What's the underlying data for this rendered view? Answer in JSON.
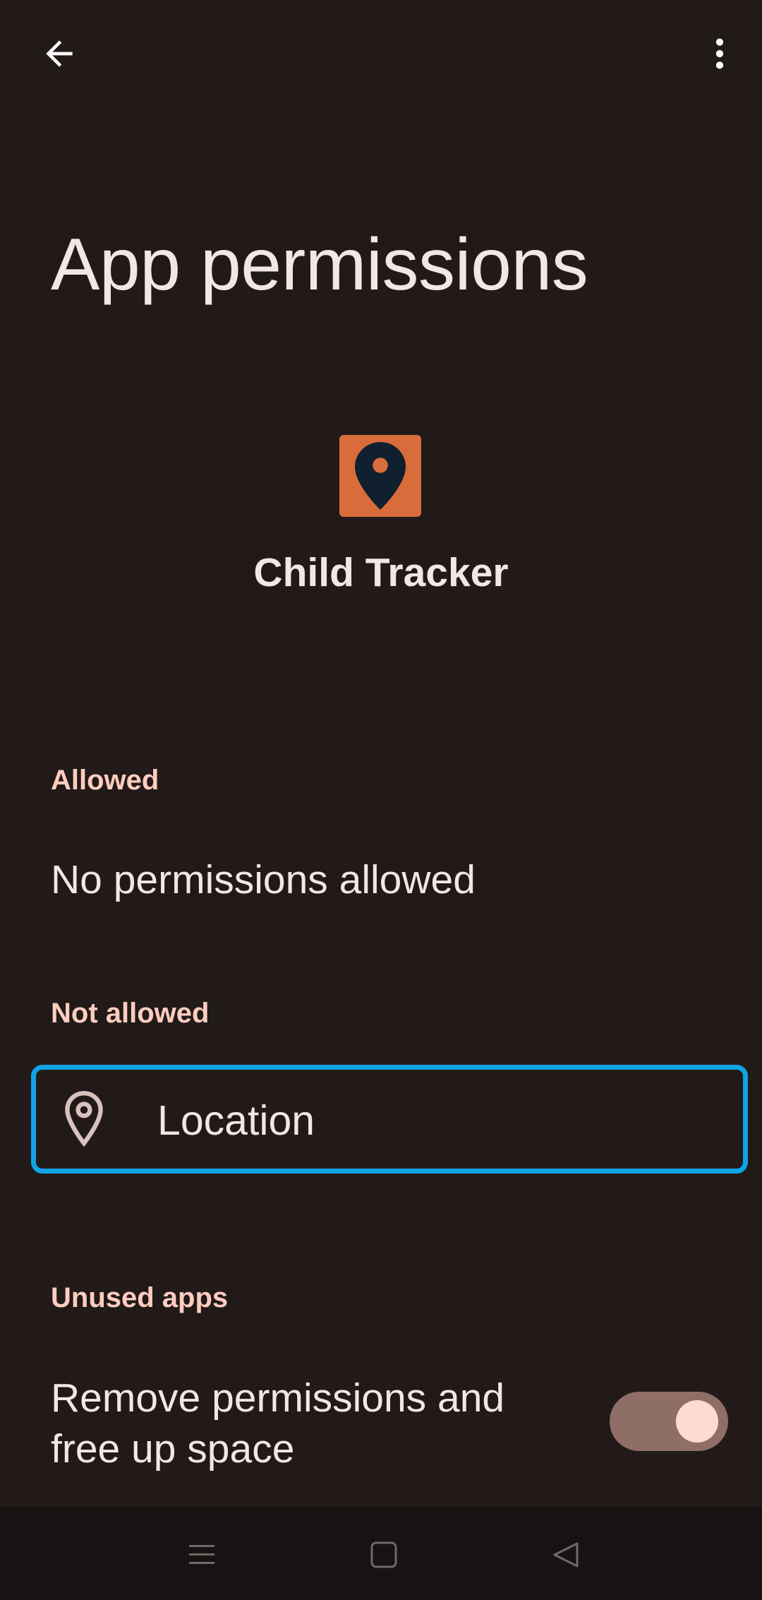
{
  "header": {
    "back_icon": "arrow-back-icon",
    "more_icon": "more-vert-icon",
    "title": "App permissions"
  },
  "app": {
    "icon": "location-pin-icon",
    "icon_bg": "#d96c3b",
    "name": "Child Tracker"
  },
  "sections": {
    "allowed": {
      "header": "Allowed",
      "empty_text": "No permissions allowed"
    },
    "not_allowed": {
      "header": "Not allowed",
      "items": [
        {
          "label": "Location",
          "icon": "location-outline-icon",
          "focused": true
        }
      ]
    },
    "unused_apps": {
      "header": "Unused apps",
      "setting_label_line1": "Remove permissions and",
      "setting_label_line2": "free up space",
      "toggle_on": true
    }
  },
  "navbar": {
    "recents_icon": "menu-icon",
    "home_icon": "home-square-icon",
    "back_icon": "back-triangle-icon"
  },
  "colors": {
    "background": "#211a19",
    "accent_header": "#ffcdbf",
    "focus_border": "#0fa4e6",
    "toggle_track": "#8f6e66",
    "toggle_knob": "#ffdad2"
  }
}
